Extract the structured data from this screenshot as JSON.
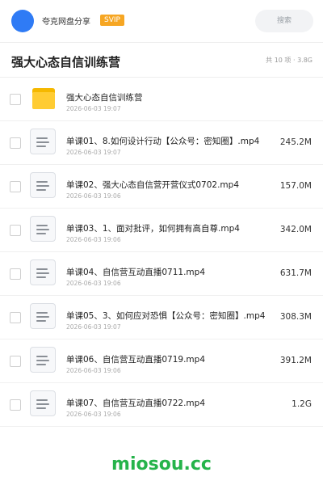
{
  "header": {
    "share_title": "夸克网盘分享",
    "vip_label": "SVIP",
    "search_placeholder": "搜索",
    "avatar_color": "#2f7bf5",
    "vip_color": "#f6a623"
  },
  "folder": {
    "title": "强大心态自信训练营",
    "meta": "共 10 项 · 3.8G"
  },
  "files": [
    {
      "type": "folder",
      "icon": "folder-icon",
      "name": "强大心态自信训练营",
      "date": "2026-06-03 19:07",
      "size": ""
    },
    {
      "type": "file",
      "icon": "document-icon",
      "name": "单课01、8.如何设计行动【公众号：密知圈】.mp4",
      "date": "2026-06-03 19:07",
      "size": "245.2M"
    },
    {
      "type": "file",
      "icon": "document-icon",
      "name": "单课02、强大心态自信营开营仪式0702.mp4",
      "date": "2026-06-03 19:06",
      "size": "157.0M"
    },
    {
      "type": "file",
      "icon": "document-icon",
      "name": "单课03、1、面对批评，如何拥有高自尊.mp4",
      "date": "2026-06-03 19:06",
      "size": "342.0M"
    },
    {
      "type": "file",
      "icon": "document-icon",
      "name": "单课04、自信营互动直播0711.mp4",
      "date": "2026-06-03 19:06",
      "size": "631.7M"
    },
    {
      "type": "file",
      "icon": "document-icon",
      "name": "单课05、3、如何应对恐惧【公众号：密知圈】.mp4",
      "date": "2026-06-03 19:07",
      "size": "308.3M"
    },
    {
      "type": "file",
      "icon": "document-icon",
      "name": "单课06、自信营互动直播0719.mp4",
      "date": "2026-06-03 19:06",
      "size": "391.2M"
    },
    {
      "type": "file",
      "icon": "document-icon",
      "name": "单课07、自信营互动直播0722.mp4",
      "date": "2026-06-03 19:06",
      "size": "1.2G"
    }
  ],
  "watermark": "miosou.cc"
}
